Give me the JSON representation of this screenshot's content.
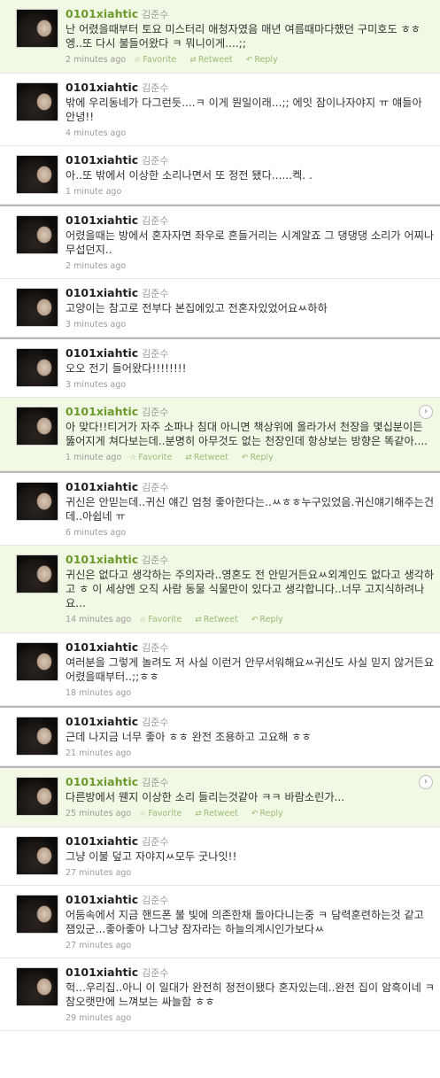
{
  "actions": {
    "favorite": "Favorite",
    "retweet": "Retweet",
    "reply": "Reply"
  },
  "tweets": [
    {
      "user": "0101xiahtic",
      "realname": "김준수",
      "text": "난 어렸을때부터 토요 미스터리 애청자였음 매년 여름때마다했던 구미호도 ㅎㅎ 엥..또 다시 불들어왔다 ㅋ 뭐니이게....;;",
      "time": "2 minutes ago",
      "highlight": true,
      "actions": true,
      "arrow": false
    },
    {
      "user": "0101xiahtic",
      "realname": "김준수",
      "text": "밖에 우리동네가 다그런듯....ㅋ 이게 뭔일이래...;; 에잇 잠이나자야지 ㅠ 얘들아 안녕!!",
      "time": "4 minutes ago",
      "highlight": false,
      "actions": false,
      "arrow": false
    },
    {
      "user": "0101xiahtic",
      "realname": "김준수",
      "text": "아..또 밖에서 이상한 소리나면서 또 정전 됐다......켁. .",
      "time": "1 minute ago",
      "highlight": false,
      "actions": false,
      "arrow": false
    },
    {
      "user": "0101xiahtic",
      "realname": "김준수",
      "text": "어렸을때는 방에서 혼자자면 좌우로 흔들거리는 시계알죠 그 댕댕댕 소리가 어찌나 무섭던지..",
      "time": "2 minutes ago",
      "highlight": false,
      "actions": false,
      "arrow": false,
      "sep": true
    },
    {
      "user": "0101xiahtic",
      "realname": "김준수",
      "text": "고양이는 참고로 전부다 본집에있고 전혼자있었어요ㅆ하하",
      "time": "3 minutes ago",
      "highlight": false,
      "actions": false,
      "arrow": false
    },
    {
      "user": "0101xiahtic",
      "realname": "김준수",
      "text": "오오 전기 들어왔다!!!!!!!!",
      "time": "3 minutes ago",
      "highlight": false,
      "actions": false,
      "arrow": false,
      "sep": true
    },
    {
      "user": "0101xiahtic",
      "realname": "김준수",
      "text": "아 맞다!!티거가 자주 소파나 침대 아니면 책상위에 올라가서 천장을 몇십분이든 뚫어지게 쳐다보는데..분명히 아무것도 없는 천장인데 항상보는 방향은 똑같아....",
      "time": "1 minute ago",
      "highlight": true,
      "actions": true,
      "arrow": true
    },
    {
      "user": "0101xiahtic",
      "realname": "김준수",
      "text": "귀신은 안믿는데..귀신 얘긴 엄청 좋아한다는..ㅆㅎㅎ누구있었음.귀신얘기해주는건데..아쉽네 ㅠ",
      "time": "6 minutes ago",
      "highlight": false,
      "actions": false,
      "arrow": false,
      "sep": true
    },
    {
      "user": "0101xiahtic",
      "realname": "김준수",
      "text": "귀신은 없다고 생각하는 주의자라..영혼도 전 안믿거든요ㅆ외계인도 없다고 생각하고 ㅎ 이 세상엔 오직 사람 동물 식물만이 있다고 생각합니다..너무 고지식하려나요...",
      "time": "14 minutes ago",
      "highlight": true,
      "actions": true,
      "arrow": false
    },
    {
      "user": "0101xiahtic",
      "realname": "김준수",
      "text": "여러분을 그렇게 놀려도 저 사실 이런거 안무서워해요ㅆ귀신도 사실 믿지 않거든요 어렸을때부터..;;ㅎㅎ",
      "time": "18 minutes ago",
      "highlight": false,
      "actions": false,
      "arrow": false
    },
    {
      "user": "0101xiahtic",
      "realname": "김준수",
      "text": "근데 나지금 너무 좋아 ㅎㅎ 완전 조용하고 고요해 ㅎㅎ",
      "time": "21 minutes ago",
      "highlight": false,
      "actions": false,
      "arrow": false,
      "sep": true
    },
    {
      "user": "0101xiahtic",
      "realname": "김준수",
      "text": "다른방에서 웬지 이상한 소리 들리는것같아 ㅋㅋ 바람소린가...",
      "time": "25 minutes ago",
      "highlight": true,
      "actions": true,
      "arrow": true,
      "sep": true
    },
    {
      "user": "0101xiahtic",
      "realname": "김준수",
      "text": "그냥 이불 덮고 자야지ㅆ모두 굿나잇!!",
      "time": "27 minutes ago",
      "highlight": false,
      "actions": false,
      "arrow": false
    },
    {
      "user": "0101xiahtic",
      "realname": "김준수",
      "text": "어둠속에서 지금 핸드폰 불 빛에 의존한채 돌아다니는중 ㅋ 담력훈련하는것 같고 잼있군...좋아좋아 나그냥 잠자라는 하늘의계시인가보다ㅆ",
      "time": "27 minutes ago",
      "highlight": false,
      "actions": false,
      "arrow": false
    },
    {
      "user": "0101xiahtic",
      "realname": "김준수",
      "text": "헉...우리집..아니 이 일대가 완전히 정전이됐다 혼자있는데..완전 집이 암흑이네 ㅋ참오랫만에 느껴보는 싸늘함 ㅎㅎ",
      "time": "29 minutes ago",
      "highlight": false,
      "actions": false,
      "arrow": false
    }
  ]
}
